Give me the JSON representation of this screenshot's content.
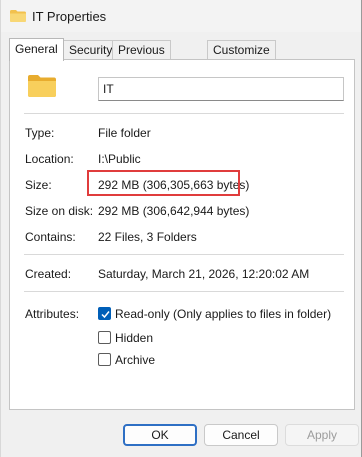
{
  "window": {
    "title": "IT Properties"
  },
  "tabs": [
    {
      "label": "General",
      "active": true
    },
    {
      "label": "Security",
      "active": false
    },
    {
      "label": "Previous Versions",
      "active": false
    },
    {
      "label": "Customize",
      "active": false
    }
  ],
  "general": {
    "name_value": "IT",
    "type_label": "Type:",
    "type_value": "File folder",
    "location_label": "Location:",
    "location_value": "I:\\Public",
    "size_label": "Size:",
    "size_value": "292 MB (306,305,663 bytes)",
    "size_on_disk_label": "Size on disk:",
    "size_on_disk_value": "292 MB (306,642,944 bytes)",
    "contains_label": "Contains:",
    "contains_value": "22 Files, 3 Folders",
    "created_label": "Created:",
    "created_value": "Saturday, March 21, 2026, 12:20:02 AM",
    "attributes_label": "Attributes:",
    "attributes": [
      {
        "label": "Read-only (Only applies to files in folder)",
        "checked": true
      },
      {
        "label": "Hidden",
        "checked": false
      },
      {
        "label": "Archive",
        "checked": false
      }
    ]
  },
  "buttons": {
    "ok": "OK",
    "cancel": "Cancel",
    "apply": "Apply"
  },
  "colors": {
    "accent": "#005fb8",
    "highlight_border": "#e03c3c",
    "folder": "#f2c14e"
  }
}
